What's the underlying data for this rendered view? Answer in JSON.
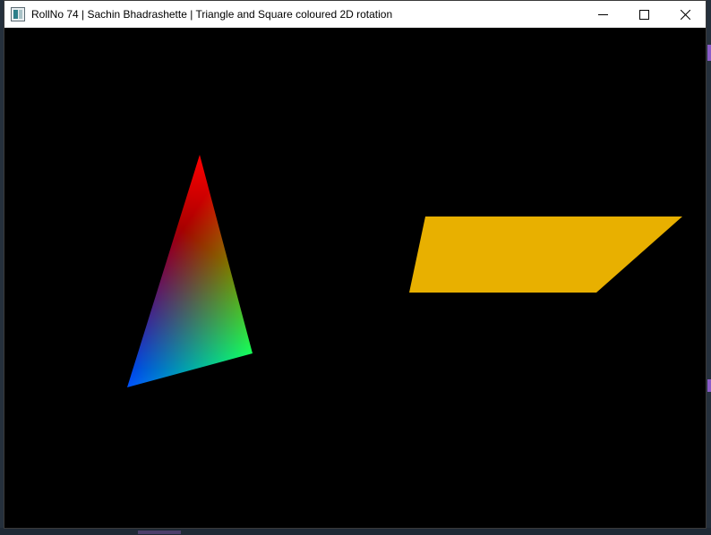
{
  "window": {
    "title": "RollNo 74 | Sachin Bhadrashette | Triangle and Square coloured 2D rotation",
    "app_icon": "application-window-icon",
    "controls": {
      "minimize_icon": "minimize-icon",
      "maximize_icon": "maximize-icon",
      "close_icon": "close-icon"
    }
  },
  "scene": {
    "background_color": "#000000",
    "triangle": {
      "vertex_colors": [
        "#ff0000",
        "#0000ff",
        "#00ff00"
      ]
    },
    "square": {
      "fill_color": "#e8b000"
    }
  }
}
